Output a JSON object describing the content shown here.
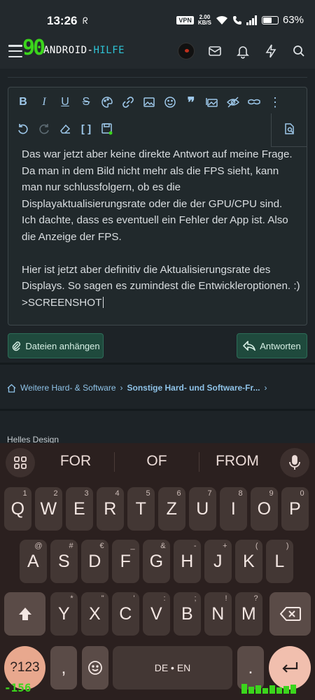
{
  "status_bar": {
    "time": "13:26",
    "vpn": "VPN",
    "net_speed_value": "2.00",
    "net_speed_unit": "KB/S",
    "battery": "63%",
    "battery_level": 0.63
  },
  "header": {
    "logo_mark": "90",
    "logo_text_a": "ANDROID-",
    "logo_text_b": "HILFE"
  },
  "editor": {
    "paragraphs": [
      "Das war jetzt aber keine direkte Antwort auf meine Frage. Da man in dem Bild nicht mehr als die FPS sieht, kann man nur schlussfolgern, ob es die Displayaktualisierungsrate oder die der GPU/CPU sind.",
      "Ich dachte, dass es eventuell ein Fehler der App ist. Also die Anzeige der FPS.",
      "",
      "Hier ist jetzt aber definitiv die Aktualisierungsrate des Displays. So sagen es zumindest die Entwickleroptionen. :)",
      ">SCREENSHOT"
    ]
  },
  "actions": {
    "attach_label": "Dateien anhängen",
    "reply_label": "Antworten"
  },
  "breadcrumb": {
    "item1": "Weitere Hard- & Software",
    "item2": "Sonstige Hard- und Software-Fr..."
  },
  "footer": {
    "theme_link": "Helles Design"
  },
  "keyboard": {
    "suggestions": [
      "FOR",
      "OF",
      "FROM"
    ],
    "row1": [
      {
        "k": "Q",
        "h": "1"
      },
      {
        "k": "W",
        "h": "2"
      },
      {
        "k": "E",
        "h": "3"
      },
      {
        "k": "R",
        "h": "4"
      },
      {
        "k": "T",
        "h": "5"
      },
      {
        "k": "Z",
        "h": "6"
      },
      {
        "k": "U",
        "h": "7"
      },
      {
        "k": "I",
        "h": "8"
      },
      {
        "k": "O",
        "h": "9"
      },
      {
        "k": "P",
        "h": "0"
      }
    ],
    "row2": [
      {
        "k": "A",
        "h": "@"
      },
      {
        "k": "S",
        "h": "#"
      },
      {
        "k": "D",
        "h": "€"
      },
      {
        "k": "F",
        "h": "_"
      },
      {
        "k": "G",
        "h": "&"
      },
      {
        "k": "H",
        "h": "-"
      },
      {
        "k": "J",
        "h": "+"
      },
      {
        "k": "K",
        "h": "("
      },
      {
        "k": "L",
        "h": ")"
      }
    ],
    "row3": [
      {
        "k": "Y",
        "h": "*"
      },
      {
        "k": "X",
        "h": "\""
      },
      {
        "k": "C",
        "h": "'"
      },
      {
        "k": "V",
        "h": ":"
      },
      {
        "k": "B",
        "h": ";"
      },
      {
        "k": "N",
        "h": "!"
      },
      {
        "k": "M",
        "h": "?"
      }
    ],
    "sym_label": "?123",
    "comma_label": ",",
    "space_label": "DE • EN",
    "period_label": ".",
    "latency": "-156"
  }
}
